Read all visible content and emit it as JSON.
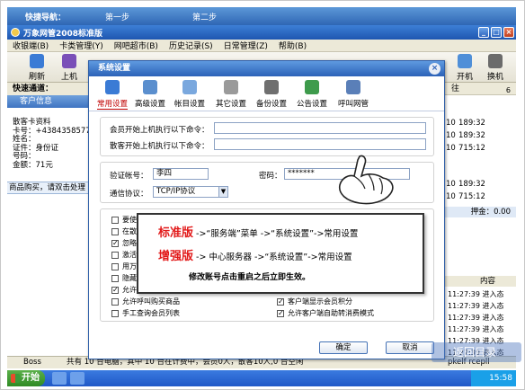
{
  "breadcrumb": {
    "label": "快捷导航：",
    "step1": "第一步",
    "step2": "第二步"
  },
  "app": {
    "title": "万象网管2008标准版"
  },
  "window": {
    "min": "_",
    "max": "□",
    "close": "×"
  },
  "menu": [
    "收银端(B)",
    "卡类管理(Y)",
    "网吧超市(B)",
    "历史记录(S)",
    "日常管理(Z)",
    "帮助(B)"
  ],
  "toolbar": {
    "refresh": "刷新",
    "online": "上机",
    "boot": "开机",
    "swap": "换机"
  },
  "left": {
    "channel_label": "快速通道：",
    "customer_info": "客户信息",
    "info_lines": [
      "散客卡资料",
      "卡号：+4384358577",
      "姓名：",
      "证件：身份证",
      "号码：",
      "金额：71元"
    ],
    "buy_label": "商品购买，请双击处理"
  },
  "right": {
    "header": "往",
    "number": "6",
    "rows": [
      {
        "a": "10",
        "b": "189:32"
      },
      {
        "a": "10",
        "b": "189:32"
      },
      {
        "a": "10",
        "b": "715:12"
      },
      {
        "a": "10",
        "b": "189:32"
      },
      {
        "a": "10",
        "b": "715:12"
      }
    ],
    "sum": "押金：0.00",
    "log_header": "内容",
    "logs": [
      {
        "t": "11:27:39",
        "c": "进入态"
      },
      {
        "t": "11:27:39",
        "c": "进入态"
      },
      {
        "t": "11:27:39",
        "c": "进入态"
      },
      {
        "t": "11:27:39",
        "c": "进入态"
      },
      {
        "t": "11:27:39",
        "c": "进入态"
      },
      {
        "t": "11:27:39",
        "c": "进入态"
      },
      {
        "t": "11:27:39",
        "c": "进入态"
      }
    ],
    "tail": "pkelf rcepll"
  },
  "dialog": {
    "title": "系统设置",
    "close": "×",
    "tabs": [
      "常用设置",
      "高级设置",
      "帐目设置",
      "其它设置",
      "备份设置",
      "公告设置",
      "呼叫网管"
    ],
    "cmd1_label": "会员开始上机执行以下命令：",
    "cmd2_label": "散客开始上机执行以下命令：",
    "account_label": "验证帐号：",
    "account_value": "李四",
    "password_label": "密码：",
    "password_value": "*******",
    "protocol_label": "通信协议：",
    "protocol_value": "TCP/IP协议",
    "checks_left": [
      "要使用",
      "在散客",
      "忽略",
      "激活会",
      "用万显",
      "隐藏",
      "允许",
      "允许呼叫购买商品",
      "手工查询会员列表"
    ],
    "checks_right": [
      "客户端显示会员积分",
      "允许客户端自助转消费模式"
    ],
    "checked_left": [
      false,
      false,
      true,
      false,
      false,
      false,
      true,
      false,
      false
    ],
    "checked_right": [
      true,
      true
    ],
    "ok": "确定",
    "cancel": "取消"
  },
  "note": {
    "std": "标准版",
    "std_path": "->“服务端”菜单 ->“系统设置”->常用设置",
    "pro": "增强版",
    "pro_path": "->    中心服务器  ->“系统设置”->常用设置",
    "tip": "修改账号点击重启之后立即生效。"
  },
  "status": {
    "user": "Boss",
    "summary": "共有 10 台电脑，其中 10 台在计费中，会员0人，散客10人,0 台空闲",
    "right": "pkelf rcepll"
  },
  "taskbar": {
    "start": "开始",
    "clock": "15:58"
  },
  "watermark": "返回目录"
}
